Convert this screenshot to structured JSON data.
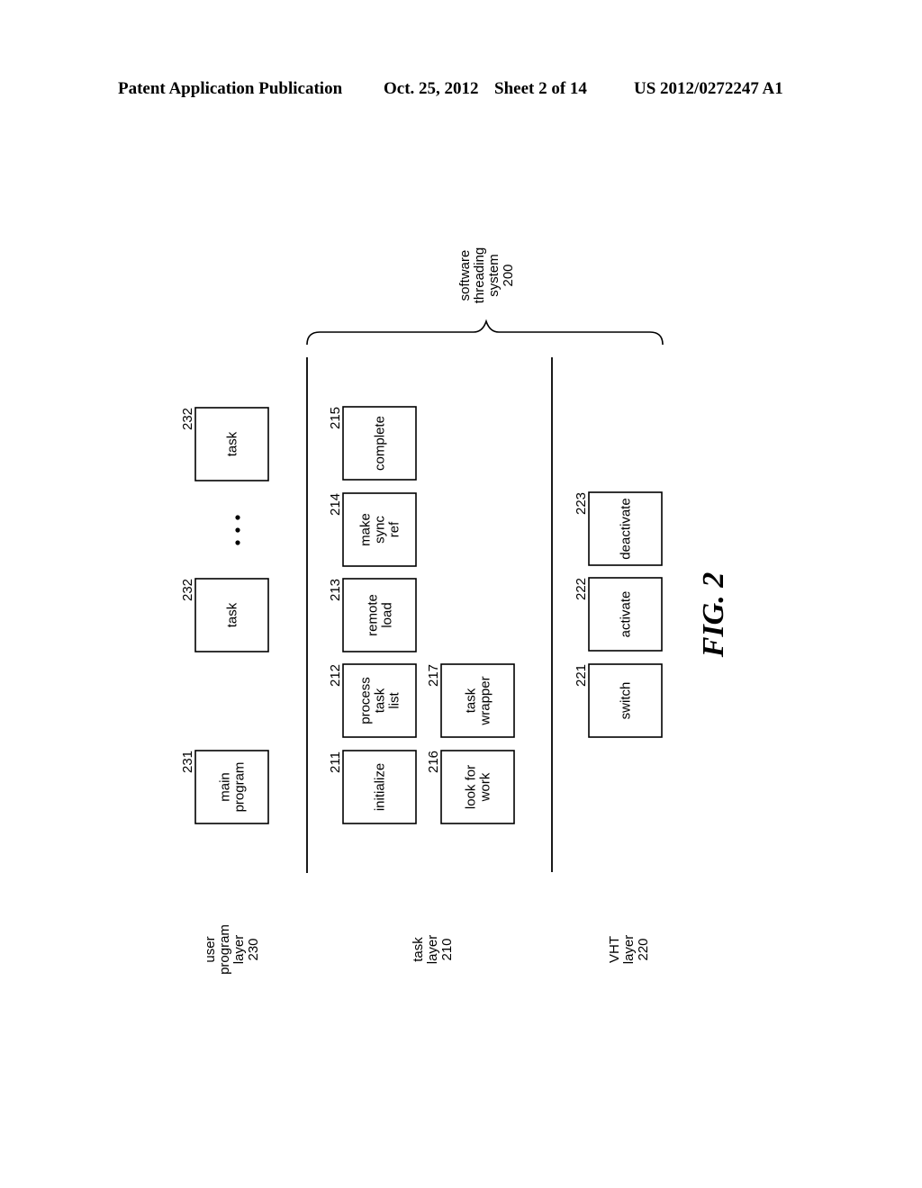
{
  "header": {
    "publication": "Patent Application Publication",
    "date": "Oct. 25, 2012",
    "sheet": "Sheet 2 of 14",
    "number": "US 2012/0272247 A1"
  },
  "figure": {
    "label": "FIG. 2",
    "orientation": "rotated 90° counterclockwise",
    "system": {
      "lines": [
        "software",
        "threading",
        "system",
        "200"
      ]
    },
    "layers": [
      {
        "id": "230",
        "lines": [
          "user",
          "program",
          "layer",
          "230"
        ]
      },
      {
        "id": "210",
        "lines": [
          "task",
          "layer",
          "210"
        ]
      },
      {
        "id": "220",
        "lines": [
          "VHT",
          "layer",
          "220"
        ]
      }
    ],
    "boxes": [
      {
        "ref": "231",
        "lines": [
          "main",
          "program"
        ],
        "layer": "230"
      },
      {
        "ref": "232",
        "lines": [
          "task"
        ],
        "layer": "230"
      },
      {
        "ref": "232",
        "lines": [
          "task"
        ],
        "layer": "230"
      },
      {
        "ref": "211",
        "lines": [
          "initialize"
        ],
        "layer": "210"
      },
      {
        "ref": "212",
        "lines": [
          "process",
          "task",
          "list"
        ],
        "layer": "210"
      },
      {
        "ref": "213",
        "lines": [
          "remote",
          "load"
        ],
        "layer": "210"
      },
      {
        "ref": "214",
        "lines": [
          "make",
          "sync",
          "ref"
        ],
        "layer": "210"
      },
      {
        "ref": "215",
        "lines": [
          "complete"
        ],
        "layer": "210"
      },
      {
        "ref": "216",
        "lines": [
          "look for",
          "work"
        ],
        "layer": "210"
      },
      {
        "ref": "217",
        "lines": [
          "task",
          "wrapper"
        ],
        "layer": "210"
      },
      {
        "ref": "221",
        "lines": [
          "switch"
        ],
        "layer": "220"
      },
      {
        "ref": "222",
        "lines": [
          "activate"
        ],
        "layer": "220"
      },
      {
        "ref": "223",
        "lines": [
          "deactivate"
        ],
        "layer": "220"
      }
    ],
    "ellipsis": "..."
  }
}
